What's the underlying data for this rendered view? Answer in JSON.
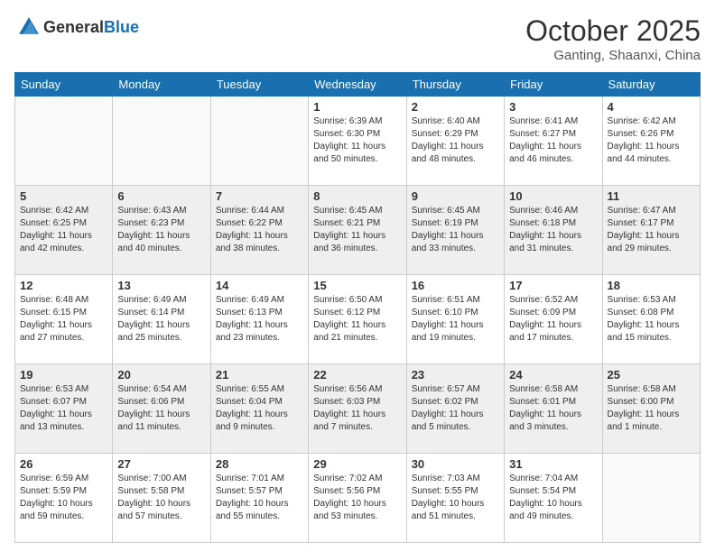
{
  "header": {
    "logo_general": "General",
    "logo_blue": "Blue",
    "month": "October 2025",
    "location": "Ganting, Shaanxi, China"
  },
  "weekdays": [
    "Sunday",
    "Monday",
    "Tuesday",
    "Wednesday",
    "Thursday",
    "Friday",
    "Saturday"
  ],
  "rows": [
    [
      {
        "day": "",
        "info": ""
      },
      {
        "day": "",
        "info": ""
      },
      {
        "day": "",
        "info": ""
      },
      {
        "day": "1",
        "info": "Sunrise: 6:39 AM\nSunset: 6:30 PM\nDaylight: 11 hours\nand 50 minutes."
      },
      {
        "day": "2",
        "info": "Sunrise: 6:40 AM\nSunset: 6:29 PM\nDaylight: 11 hours\nand 48 minutes."
      },
      {
        "day": "3",
        "info": "Sunrise: 6:41 AM\nSunset: 6:27 PM\nDaylight: 11 hours\nand 46 minutes."
      },
      {
        "day": "4",
        "info": "Sunrise: 6:42 AM\nSunset: 6:26 PM\nDaylight: 11 hours\nand 44 minutes."
      }
    ],
    [
      {
        "day": "5",
        "info": "Sunrise: 6:42 AM\nSunset: 6:25 PM\nDaylight: 11 hours\nand 42 minutes."
      },
      {
        "day": "6",
        "info": "Sunrise: 6:43 AM\nSunset: 6:23 PM\nDaylight: 11 hours\nand 40 minutes."
      },
      {
        "day": "7",
        "info": "Sunrise: 6:44 AM\nSunset: 6:22 PM\nDaylight: 11 hours\nand 38 minutes."
      },
      {
        "day": "8",
        "info": "Sunrise: 6:45 AM\nSunset: 6:21 PM\nDaylight: 11 hours\nand 36 minutes."
      },
      {
        "day": "9",
        "info": "Sunrise: 6:45 AM\nSunset: 6:19 PM\nDaylight: 11 hours\nand 33 minutes."
      },
      {
        "day": "10",
        "info": "Sunrise: 6:46 AM\nSunset: 6:18 PM\nDaylight: 11 hours\nand 31 minutes."
      },
      {
        "day": "11",
        "info": "Sunrise: 6:47 AM\nSunset: 6:17 PM\nDaylight: 11 hours\nand 29 minutes."
      }
    ],
    [
      {
        "day": "12",
        "info": "Sunrise: 6:48 AM\nSunset: 6:15 PM\nDaylight: 11 hours\nand 27 minutes."
      },
      {
        "day": "13",
        "info": "Sunrise: 6:49 AM\nSunset: 6:14 PM\nDaylight: 11 hours\nand 25 minutes."
      },
      {
        "day": "14",
        "info": "Sunrise: 6:49 AM\nSunset: 6:13 PM\nDaylight: 11 hours\nand 23 minutes."
      },
      {
        "day": "15",
        "info": "Sunrise: 6:50 AM\nSunset: 6:12 PM\nDaylight: 11 hours\nand 21 minutes."
      },
      {
        "day": "16",
        "info": "Sunrise: 6:51 AM\nSunset: 6:10 PM\nDaylight: 11 hours\nand 19 minutes."
      },
      {
        "day": "17",
        "info": "Sunrise: 6:52 AM\nSunset: 6:09 PM\nDaylight: 11 hours\nand 17 minutes."
      },
      {
        "day": "18",
        "info": "Sunrise: 6:53 AM\nSunset: 6:08 PM\nDaylight: 11 hours\nand 15 minutes."
      }
    ],
    [
      {
        "day": "19",
        "info": "Sunrise: 6:53 AM\nSunset: 6:07 PM\nDaylight: 11 hours\nand 13 minutes."
      },
      {
        "day": "20",
        "info": "Sunrise: 6:54 AM\nSunset: 6:06 PM\nDaylight: 11 hours\nand 11 minutes."
      },
      {
        "day": "21",
        "info": "Sunrise: 6:55 AM\nSunset: 6:04 PM\nDaylight: 11 hours\nand 9 minutes."
      },
      {
        "day": "22",
        "info": "Sunrise: 6:56 AM\nSunset: 6:03 PM\nDaylight: 11 hours\nand 7 minutes."
      },
      {
        "day": "23",
        "info": "Sunrise: 6:57 AM\nSunset: 6:02 PM\nDaylight: 11 hours\nand 5 minutes."
      },
      {
        "day": "24",
        "info": "Sunrise: 6:58 AM\nSunset: 6:01 PM\nDaylight: 11 hours\nand 3 minutes."
      },
      {
        "day": "25",
        "info": "Sunrise: 6:58 AM\nSunset: 6:00 PM\nDaylight: 11 hours\nand 1 minute."
      }
    ],
    [
      {
        "day": "26",
        "info": "Sunrise: 6:59 AM\nSunset: 5:59 PM\nDaylight: 10 hours\nand 59 minutes."
      },
      {
        "day": "27",
        "info": "Sunrise: 7:00 AM\nSunset: 5:58 PM\nDaylight: 10 hours\nand 57 minutes."
      },
      {
        "day": "28",
        "info": "Sunrise: 7:01 AM\nSunset: 5:57 PM\nDaylight: 10 hours\nand 55 minutes."
      },
      {
        "day": "29",
        "info": "Sunrise: 7:02 AM\nSunset: 5:56 PM\nDaylight: 10 hours\nand 53 minutes."
      },
      {
        "day": "30",
        "info": "Sunrise: 7:03 AM\nSunset: 5:55 PM\nDaylight: 10 hours\nand 51 minutes."
      },
      {
        "day": "31",
        "info": "Sunrise: 7:04 AM\nSunset: 5:54 PM\nDaylight: 10 hours\nand 49 minutes."
      },
      {
        "day": "",
        "info": ""
      }
    ]
  ]
}
